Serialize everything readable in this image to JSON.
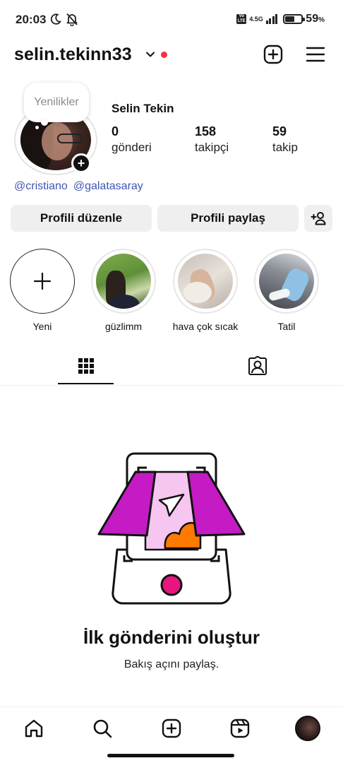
{
  "status_bar": {
    "time": "20:03",
    "network_type": "4.5G",
    "volte_label": "Vo LTE",
    "battery_percent_label": "59",
    "battery_percent_unit": "%",
    "battery_level": 0.59,
    "icons": [
      "moon-icon",
      "bell-off-icon",
      "volte-icon",
      "signal-icon",
      "battery-icon"
    ]
  },
  "header": {
    "username": "selin.tekinn33",
    "icons": [
      "chevron-down-icon",
      "notification-dot",
      "create-icon",
      "menu-icon"
    ],
    "accent_red": "#ff2d3f"
  },
  "profile": {
    "note_text": "Yenilikler",
    "full_name": "Selin Tekin",
    "stats": [
      {
        "value": "0",
        "label": "gönderi"
      },
      {
        "value": "158",
        "label": "takipçi"
      },
      {
        "value": "59",
        "label": "takip"
      }
    ],
    "mentions": [
      "@cristiano",
      "@galatasaray"
    ],
    "mention_color": "#4156b3"
  },
  "actions": {
    "edit_label": "Profili düzenle",
    "share_label": "Profili paylaş",
    "add_user_icon": "add-user-icon"
  },
  "highlights": [
    {
      "label": "Yeni"
    },
    {
      "label": "güzlimm"
    },
    {
      "label": "hava çok sıcak"
    },
    {
      "label": "Tatil"
    }
  ],
  "tabs": [
    {
      "name": "grid",
      "icon": "grid-icon",
      "active": true
    },
    {
      "name": "tagged",
      "icon": "tagged-icon",
      "active": false
    }
  ],
  "empty_state": {
    "title": "İlk gönderini oluştur",
    "subtitle": "Bakış açını paylaş.",
    "colors": {
      "magenta": "#c41bc4",
      "orange": "#ff7a00",
      "pink": "#f7c6f0",
      "record": "#e8157f"
    }
  },
  "bottom_nav": {
    "icons": [
      "home-icon",
      "search-icon",
      "create-icon",
      "reels-icon",
      "profile-avatar"
    ]
  }
}
